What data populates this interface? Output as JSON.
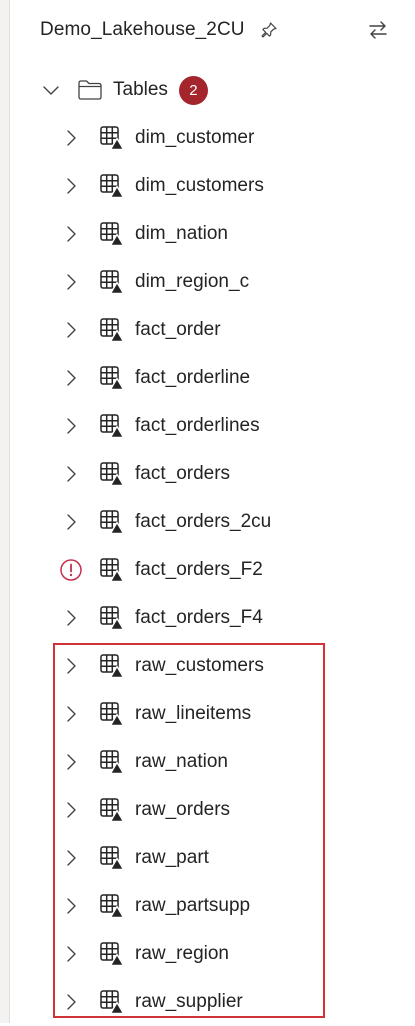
{
  "header": {
    "title": "Demo_Lakehouse_2CU"
  },
  "folder": {
    "label": "Tables",
    "badge_count": "2"
  },
  "colors": {
    "badge_bg": "#a4262c",
    "error": "#c4314b",
    "highlight": "#d13438"
  },
  "tables": [
    {
      "name": "dim_customer",
      "lead": "chevron"
    },
    {
      "name": "dim_customers",
      "lead": "chevron"
    },
    {
      "name": "dim_nation",
      "lead": "chevron"
    },
    {
      "name": "dim_region_c",
      "lead": "chevron"
    },
    {
      "name": "fact_order",
      "lead": "chevron"
    },
    {
      "name": "fact_orderline",
      "lead": "chevron"
    },
    {
      "name": "fact_orderlines",
      "lead": "chevron"
    },
    {
      "name": "fact_orders",
      "lead": "chevron"
    },
    {
      "name": "fact_orders_2cu",
      "lead": "chevron"
    },
    {
      "name": "fact_orders_F2",
      "lead": "error"
    },
    {
      "name": "fact_orders_F4",
      "lead": "chevron"
    },
    {
      "name": "raw_customers",
      "lead": "chevron"
    },
    {
      "name": "raw_lineitems",
      "lead": "chevron"
    },
    {
      "name": "raw_nation",
      "lead": "chevron"
    },
    {
      "name": "raw_orders",
      "lead": "chevron"
    },
    {
      "name": "raw_part",
      "lead": "chevron"
    },
    {
      "name": "raw_partsupp",
      "lead": "chevron"
    },
    {
      "name": "raw_region",
      "lead": "chevron"
    },
    {
      "name": "raw_supplier",
      "lead": "chevron"
    }
  ]
}
